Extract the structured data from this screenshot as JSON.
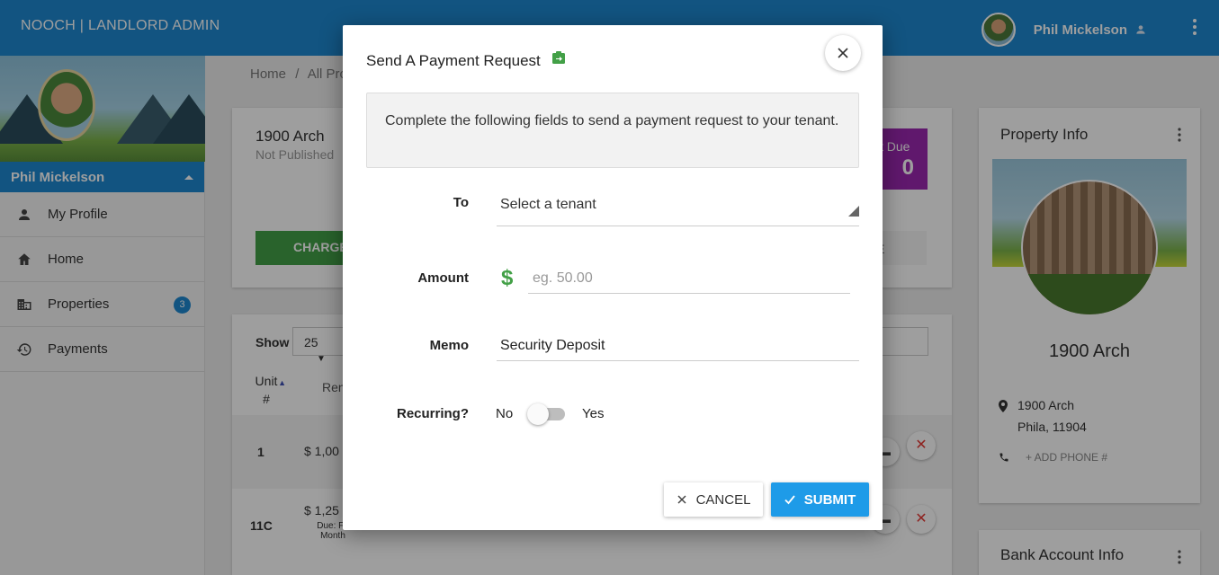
{
  "topbar": {
    "brand": "NOOCH | LANDLORD ADMIN",
    "user_name": "Phil Mickelson"
  },
  "sidebar": {
    "user_name": "Phil Mickelson",
    "items": [
      {
        "label": "My Profile",
        "icon": "person-icon"
      },
      {
        "label": "Home",
        "icon": "home-icon"
      },
      {
        "label": "Properties",
        "icon": "building-icon",
        "badge": "3"
      },
      {
        "label": "Payments",
        "icon": "history-icon"
      }
    ]
  },
  "breadcrumb": {
    "home": "Home",
    "sep": "/",
    "current": "All Pro"
  },
  "property_card": {
    "title": "1900 Arch",
    "subtitle": "Not Published",
    "charge_label": "CHARGE",
    "due_label": "t Due",
    "due_value": "0",
    "ghost_label": "E"
  },
  "table": {
    "show_label": "Show",
    "page_size": "25",
    "col_unit": "Unit #",
    "col_rent": "Ren",
    "rows": [
      {
        "unit": "1",
        "rent": "$ 1,00",
        "due": ""
      },
      {
        "unit": "11C",
        "rent": "$ 1,25",
        "due": "Due: Fir Month"
      }
    ]
  },
  "property_info": {
    "title": "Property Info",
    "name": "1900 Arch",
    "address_line1": "1900 Arch",
    "address_line2": "Phila, 11904",
    "add_phone": "+   ADD PHONE #"
  },
  "bank_info": {
    "title": "Bank Account Info"
  },
  "modal": {
    "title": "Send A Payment Request",
    "info": "Complete the following fields to send a payment request to your tenant.",
    "to_label": "To",
    "to_value": "Select a tenant",
    "amount_label": "Amount",
    "amount_placeholder": "eg. 50.00",
    "memo_label": "Memo",
    "memo_value": "Security Deposit",
    "recurring_label": "Recurring?",
    "recurring_no": "No",
    "recurring_yes": "Yes",
    "recurring_on": false,
    "cancel_label": "CANCEL",
    "submit_label": "SUBMIT"
  },
  "colors": {
    "brand_blue": "#1e88d0",
    "submit_blue": "#1e9be8",
    "green": "#43a047",
    "purple": "#9c27b0",
    "danger": "#e53935"
  }
}
